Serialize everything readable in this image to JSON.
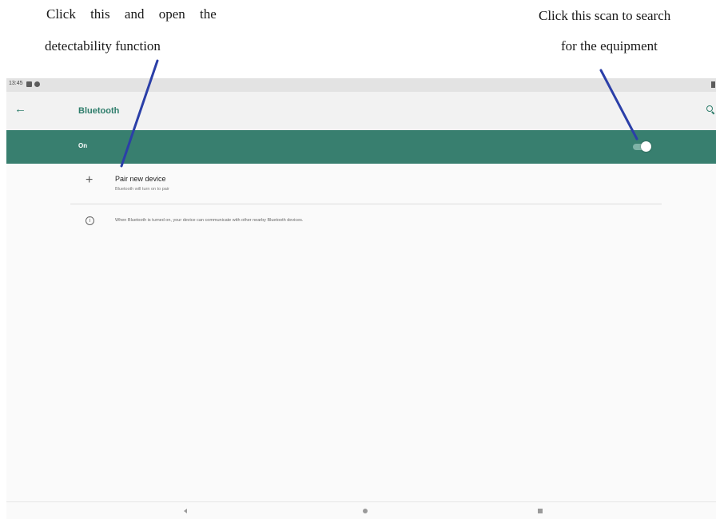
{
  "annotations": {
    "left_line1": "Click  this  and  open  the",
    "left_line2": "detectability function",
    "right_line1": "Click this scan to search",
    "right_line2": "for the equipment"
  },
  "status_bar": {
    "time": "13:45"
  },
  "app_bar": {
    "title": "Bluetooth",
    "back_icon": "arrow-left-icon",
    "search_icon": "search-icon"
  },
  "bluetooth_toggle": {
    "label": "On",
    "state": "on"
  },
  "pair_device": {
    "title": "Pair new device",
    "subtitle": "Bluetooth will turn on to pair",
    "icon": "plus-icon"
  },
  "info": {
    "text": "When Bluetooth is turned on, your device can communicate with other nearby Bluetooth devices.",
    "icon": "info-icon"
  },
  "navigation": {
    "back": "nav-back-icon",
    "home": "nav-home-icon",
    "recents": "nav-recents-icon"
  },
  "colors": {
    "accent": "#2e7d6b",
    "on_bar": "#387f6f",
    "pointer_line": "#2b3fa8"
  }
}
